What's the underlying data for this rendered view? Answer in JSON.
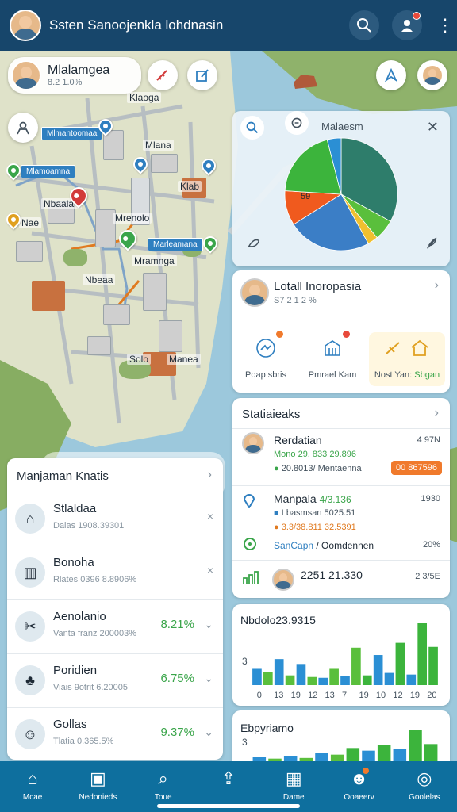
{
  "header": {
    "title": "Ssten Sanoojenkla lohdnasin",
    "search_icon": "search-icon",
    "notify_icon": "user-alert-icon",
    "menu_icon": "more-vertical-icon"
  },
  "location": {
    "title": "Mlalamgea",
    "subtitle": "8.2 1.0%"
  },
  "map_labels": [
    {
      "text": "Klaoga"
    },
    {
      "text": "Mlana"
    },
    {
      "text": "Klab"
    },
    {
      "text": "Nbaalan"
    },
    {
      "text": "Mrenolo"
    },
    {
      "text": "Nae"
    },
    {
      "text": "Mramnga"
    },
    {
      "text": "Nbeaa"
    },
    {
      "text": "Solo"
    },
    {
      "text": "Manea"
    }
  ],
  "map_tags": [
    {
      "text": "Mlmantoomaa"
    },
    {
      "text": "Mlamoamna"
    },
    {
      "text": "Marleamana"
    }
  ],
  "chart_panel": {
    "title": "Malaesm",
    "pie_label": "59"
  },
  "chart_data": {
    "type": "pie",
    "slices": [
      {
        "value": 33,
        "color": "#2e7d6b"
      },
      {
        "value": 6,
        "color": "#5abf3c"
      },
      {
        "value": 3,
        "color": "#f0c030"
      },
      {
        "value": 24,
        "color": "#3b7ec6"
      },
      {
        "value": 10,
        "color": "#f05a1e"
      },
      {
        "value": 20,
        "color": "#3cb43c"
      },
      {
        "value": 4,
        "color": "#2b8fd4"
      }
    ]
  },
  "profile": {
    "name": "Lotall Inoropasia",
    "sub": "S7 2 1 2 %",
    "actions": [
      {
        "label": "Poap sbris"
      },
      {
        "label": "Pmrael Kam"
      },
      {
        "label": "Nost Yan: ",
        "accent": "Sbgan"
      }
    ]
  },
  "stats": {
    "title": "Statiaieaks",
    "rows": [
      {
        "name": "Rerdatian",
        "value": "Mono 29. 833 29.896",
        "extra": "20.8013/ Mentaenna",
        "right": "4 97N",
        "pill": "00 867596"
      },
      {
        "name": "Manpala",
        "value_a": "4/3.136",
        "value_b": "Lbasmsan 5025.51",
        "value_c": "3.3/38.811 32.5391",
        "right": "1930",
        "sub_label": "SanCapn",
        "sub_label2": "/ Oomdennen",
        "sub_right": "20%"
      },
      {
        "name": "2251 21.330",
        "right": "2 3/5E"
      }
    ]
  },
  "bar_chart_1": {
    "title": "Nbdolo23.9315",
    "y_tick": "3",
    "x_ticks": [
      "0",
      "13",
      "19",
      "12",
      "13",
      "7",
      "19",
      "10",
      "12",
      "19",
      "20"
    ],
    "bars": [
      {
        "v": 2,
        "c": "#2b8fd4"
      },
      {
        "v": 1.6,
        "c": "#5abf3c"
      },
      {
        "v": 3.2,
        "c": "#2b8fd4"
      },
      {
        "v": 1.2,
        "c": "#5abf3c"
      },
      {
        "v": 2.6,
        "c": "#2b8fd4"
      },
      {
        "v": 1.0,
        "c": "#5abf3c"
      },
      {
        "v": 0.9,
        "c": "#2b8fd4"
      },
      {
        "v": 2.0,
        "c": "#5abf3c"
      },
      {
        "v": 1.1,
        "c": "#2b8fd4"
      },
      {
        "v": 4.6,
        "c": "#5abf3c"
      },
      {
        "v": 1.2,
        "c": "#3cb43c"
      },
      {
        "v": 3.7,
        "c": "#2b8fd4"
      },
      {
        "v": 1.5,
        "c": "#2b8fd4"
      },
      {
        "v": 5.2,
        "c": "#3cb43c"
      },
      {
        "v": 1.3,
        "c": "#2b8fd4"
      },
      {
        "v": 7.6,
        "c": "#3cb43c"
      },
      {
        "v": 4.7,
        "c": "#3cb43c"
      }
    ]
  },
  "bar_chart_2": {
    "title": "Ebpyriamo",
    "y_tick": "3",
    "bars": [
      {
        "v": 0.3,
        "c": "#2b8fd4"
      },
      {
        "v": 0.2,
        "c": "#5abf3c"
      },
      {
        "v": 0.4,
        "c": "#2b8fd4"
      },
      {
        "v": 0.25,
        "c": "#5abf3c"
      },
      {
        "v": 0.6,
        "c": "#2b8fd4"
      },
      {
        "v": 0.5,
        "c": "#5abf3c"
      },
      {
        "v": 1.0,
        "c": "#3cb43c"
      },
      {
        "v": 0.8,
        "c": "#2b8fd4"
      },
      {
        "v": 1.2,
        "c": "#3cb43c"
      },
      {
        "v": 0.9,
        "c": "#2b8fd4"
      },
      {
        "v": 2.4,
        "c": "#3cb43c"
      },
      {
        "v": 1.3,
        "c": "#3cb43c"
      }
    ]
  },
  "list": {
    "title": "Manjaman Knatis",
    "items": [
      {
        "title": "Stlaldaa",
        "sub": "Dalas 1908.39301",
        "pct": "",
        "icon": "house-icon",
        "action": "×"
      },
      {
        "title": "Bonoha",
        "sub": "Rlates 0396 8.8906%",
        "pct": "",
        "icon": "building-icon",
        "action": "×"
      },
      {
        "title": "Aenolanio",
        "sub": "Vanta franz 200003%",
        "pct": "8.21%",
        "icon": "tools-icon",
        "action": "⌄"
      },
      {
        "title": "Poridien",
        "sub": "Viais 9otrit 6.20005",
        "pct": "6.75%",
        "icon": "tree-icon",
        "action": "⌄"
      },
      {
        "title": "Gollas",
        "sub": "Tlatia 0.365.5%",
        "pct": "9.37%",
        "icon": "person-icon",
        "action": "⌄"
      }
    ]
  },
  "nav": [
    {
      "label": "Mcae",
      "icon": "home-icon"
    },
    {
      "label": "Nedonieds",
      "icon": "package-icon"
    },
    {
      "label": "Toue",
      "icon": "search-icon"
    },
    {
      "label": "",
      "icon": "upload-icon"
    },
    {
      "label": "Dame",
      "icon": "calendar-icon"
    },
    {
      "label": "Ooaeerv",
      "icon": "chat-icon"
    },
    {
      "label": "Goolelas",
      "icon": "profile-icon"
    }
  ],
  "colors": {
    "header_bg": "#17466b",
    "nav_bg": "#0e6f9e",
    "accent_green": "#3aa54a",
    "accent_orange": "#f07a2c",
    "accent_blue": "#2f7fc0"
  }
}
